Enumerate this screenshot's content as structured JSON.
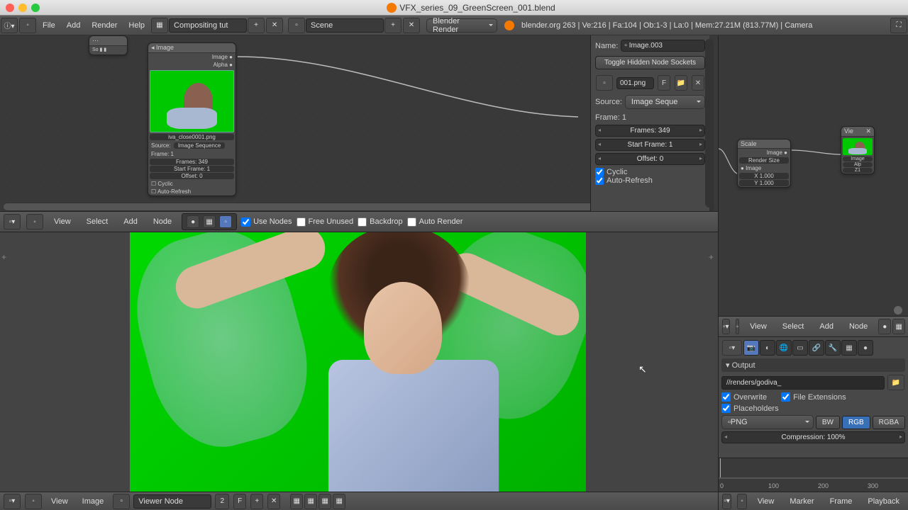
{
  "window": {
    "title": "VFX_series_09_GreenScreen_001.blend"
  },
  "topbar": {
    "menus": [
      "File",
      "Add",
      "Render",
      "Help"
    ],
    "layout": "Compositing tut",
    "scene": "Scene",
    "engine": "Blender Render",
    "stats": "blender.org 263 | Ve:216 | Fa:104 | Ob:1-3 | La:0 | Mem:27.21M (813.77M) | Camera"
  },
  "node_editor": {
    "image_node": {
      "title": "Image",
      "out_image": "Image",
      "out_alpha": "Alpha",
      "file": "iva_close0001.png",
      "source_label": "Source:",
      "source": "Image Sequence",
      "frame": "Frame: 1",
      "frames": "Frames: 349",
      "start": "Start Frame: 1",
      "offset": "Offset: 0",
      "cyclic": "Cyclic",
      "auto": "Auto-Refresh"
    },
    "scale_node": {
      "title": "Scale",
      "out_image": "Image",
      "method": "Render Size",
      "in_image": "Image",
      "x": "X 1.000",
      "y": "Y 1.000"
    },
    "viewer_node": {
      "title": "Vie",
      "in_image": "Image",
      "in_alpha": "Alp",
      "in_z": "Z1"
    },
    "menus": [
      "View",
      "Select",
      "Add",
      "Node"
    ],
    "use_nodes": "Use Nodes",
    "free_unused": "Free Unused",
    "backdrop": "Backdrop",
    "auto_render": "Auto Render"
  },
  "side_panel": {
    "name_label": "Name:",
    "name": "Image.003",
    "toggle_btn": "Toggle Hidden Node Sockets",
    "file": "001.png",
    "f_btn": "F",
    "source_label": "Source:",
    "source": "Image Seque",
    "frame": "Frame: 1",
    "frames": "Frames: 349",
    "start": "Start Frame: 1",
    "offset": "Offset: 0",
    "cyclic": "Cyclic",
    "auto": "Auto-Refresh"
  },
  "image_editor": {
    "menus": [
      "View",
      "Image"
    ],
    "display": "Viewer Node",
    "slot": "2",
    "f": "F"
  },
  "right_nodes": {
    "menus": [
      "View",
      "Select",
      "Add",
      "Node"
    ]
  },
  "properties": {
    "output_header": "Output",
    "path": "//renders/godiva_",
    "overwrite": "Overwrite",
    "file_ext": "File Extensions",
    "placeholders": "Placeholders",
    "format": "PNG",
    "bw": "BW",
    "rgb": "RGB",
    "rgba": "RGBA",
    "compression": "Compression: 100%"
  },
  "timeline": {
    "ticks": [
      "0",
      "100",
      "200",
      "300"
    ],
    "menus": [
      "View",
      "Marker",
      "Frame",
      "Playback"
    ]
  }
}
